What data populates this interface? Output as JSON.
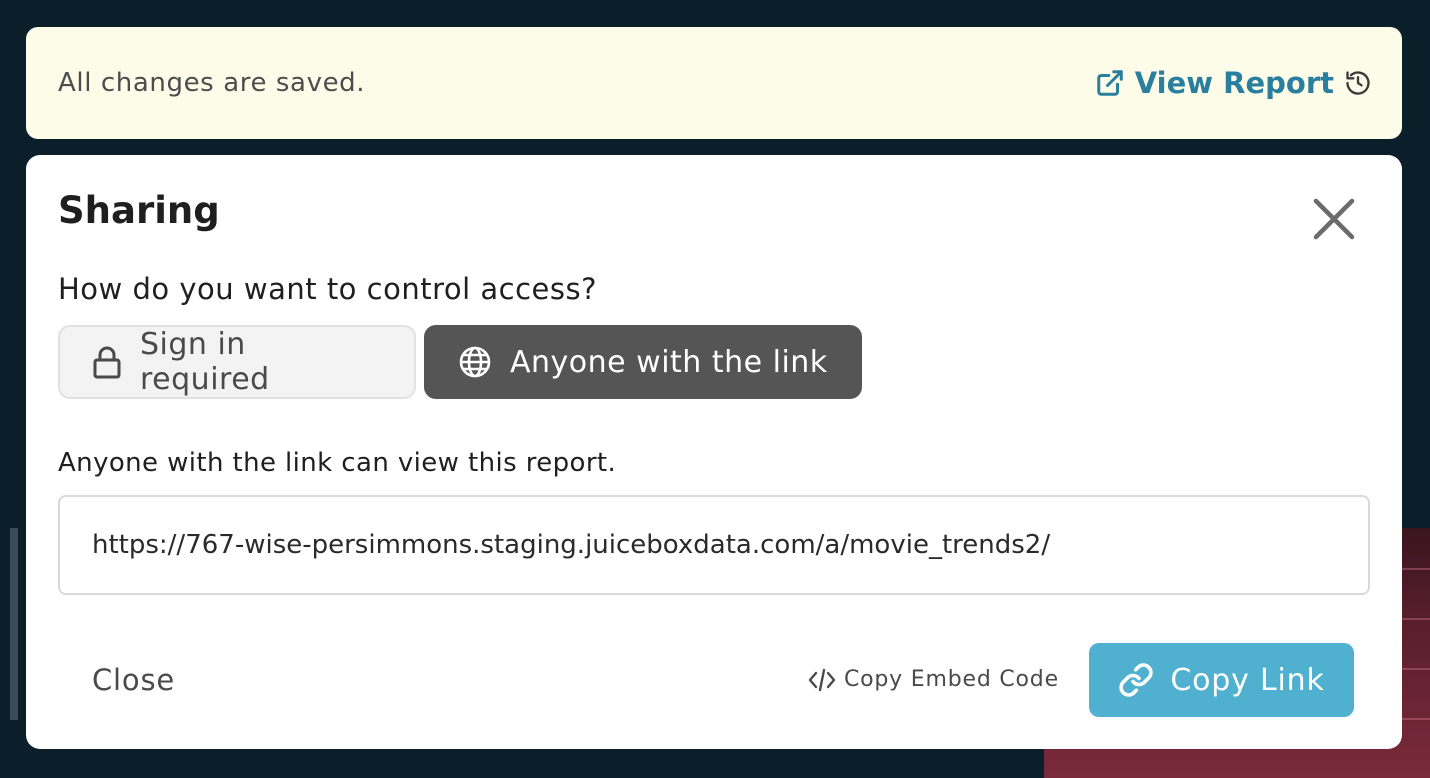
{
  "notice": {
    "message": "All changes are saved.",
    "view_report_label": "View Report"
  },
  "modal": {
    "title": "Sharing",
    "question": "How do you want to control access?",
    "access_options": [
      {
        "label": "Sign in required",
        "icon": "lock-icon",
        "selected": false
      },
      {
        "label": "Anyone with the link",
        "icon": "globe-icon",
        "selected": true
      }
    ],
    "description": "Anyone with the link can view this report.",
    "link_value": "https://767-wise-persimmons.staging.juiceboxdata.com/a/movie_trends2/",
    "close_label": "Close",
    "embed_label": "Copy Embed Code",
    "copy_link_label": "Copy Link"
  },
  "colors": {
    "notice_bg": "#fdfce8",
    "accent_link": "#2a7f9e",
    "selected_option_bg": "#555555",
    "copy_link_bg": "#4fb1cf",
    "backdrop": "#0b1f2b"
  }
}
